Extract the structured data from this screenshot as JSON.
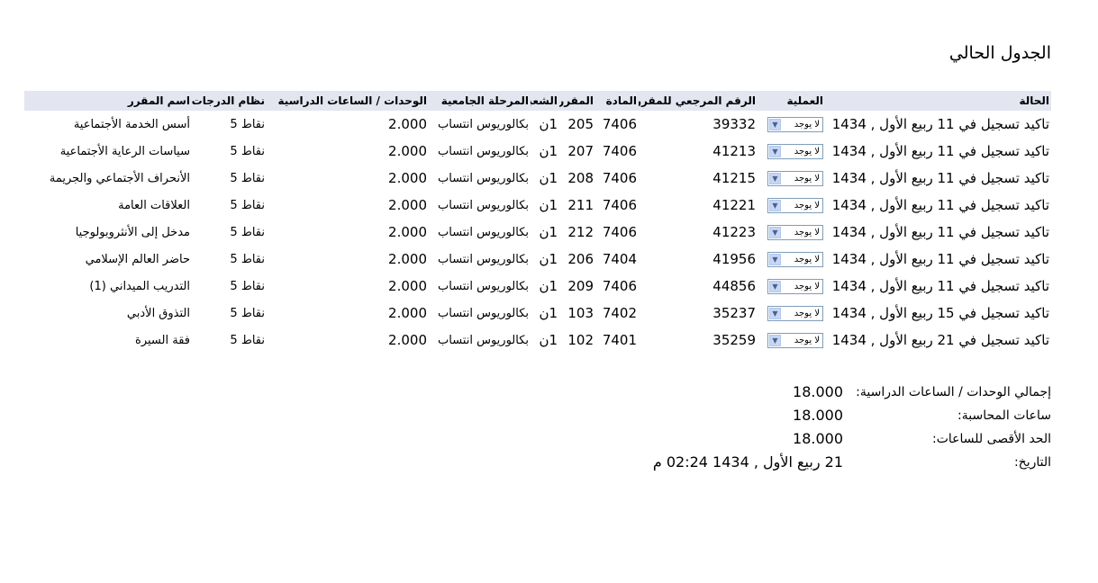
{
  "page": {
    "title": "الجدول الحالي"
  },
  "table": {
    "headers": {
      "status": "الحالة",
      "action": "العملية",
      "ref": "الرقم المرجعي للمقرر",
      "subject": "المادة",
      "course": "المقرر",
      "section": "الشعبة",
      "level": "المرحلة الجامعية",
      "units": "الوحدات / الساعات الدراسية",
      "grading": "نظام الدرجات",
      "name": "اسم المقرر"
    },
    "rows": [
      {
        "status": "تاكيد تسجيل في 11 ربيع الأول , 1434",
        "action": "لا يوجد",
        "ref": "39332",
        "subject": "7406",
        "course": "205",
        "section": "1ن",
        "level": "بكالوريوس انتساب",
        "units": "2.000",
        "grading": "نقاط 5",
        "name": "أسس الخدمة الأجتماعية"
      },
      {
        "status": "تاكيد تسجيل في 11 ربيع الأول , 1434",
        "action": "لا يوجد",
        "ref": "41213",
        "subject": "7406",
        "course": "207",
        "section": "1ن",
        "level": "بكالوريوس انتساب",
        "units": "2.000",
        "grading": "نقاط 5",
        "name": "سياسات الرعاية الأجتماعية"
      },
      {
        "status": "تاكيد تسجيل في 11 ربيع الأول , 1434",
        "action": "لا يوجد",
        "ref": "41215",
        "subject": "7406",
        "course": "208",
        "section": "1ن",
        "level": "بكالوريوس انتساب",
        "units": "2.000",
        "grading": "نقاط 5",
        "name": "الأنحراف الأجتماعي والجريمة"
      },
      {
        "status": "تاكيد تسجيل في 11 ربيع الأول , 1434",
        "action": "لا يوجد",
        "ref": "41221",
        "subject": "7406",
        "course": "211",
        "section": "1ن",
        "level": "بكالوريوس انتساب",
        "units": "2.000",
        "grading": "نقاط 5",
        "name": "العلاقات العامة"
      },
      {
        "status": "تاكيد تسجيل في 11 ربيع الأول , 1434",
        "action": "لا يوجد",
        "ref": "41223",
        "subject": "7406",
        "course": "212",
        "section": "1ن",
        "level": "بكالوريوس انتساب",
        "units": "2.000",
        "grading": "نقاط 5",
        "name": "مدخل إلى الأنثروبولوجيا"
      },
      {
        "status": "تاكيد تسجيل في 11 ربيع الأول , 1434",
        "action": "لا يوجد",
        "ref": "41956",
        "subject": "7404",
        "course": "206",
        "section": "1ن",
        "level": "بكالوريوس انتساب",
        "units": "2.000",
        "grading": "نقاط 5",
        "name": "حاضر العالم الإسلامي"
      },
      {
        "status": "تاكيد تسجيل في 11 ربيع الأول , 1434",
        "action": "لا يوجد",
        "ref": "44856",
        "subject": "7406",
        "course": "209",
        "section": "1ن",
        "level": "بكالوريوس انتساب",
        "units": "2.000",
        "grading": "نقاط 5",
        "name": "التدريب الميداني (1)"
      },
      {
        "status": "تاكيد تسجيل في 15 ربيع الأول , 1434",
        "action": "لا يوجد",
        "ref": "35237",
        "subject": "7402",
        "course": "103",
        "section": "1ن",
        "level": "بكالوريوس انتساب",
        "units": "2.000",
        "grading": "نقاط 5",
        "name": "التذوق الأدبي"
      },
      {
        "status": "تاكيد تسجيل في 21 ربيع الأول , 1434",
        "action": "لا يوجد",
        "ref": "35259",
        "subject": "7401",
        "course": "102",
        "section": "1ن",
        "level": "بكالوريوس انتساب",
        "units": "2.000",
        "grading": "نقاط 5",
        "name": "فقة السيرة"
      }
    ]
  },
  "summary": {
    "total_units_label": "إجمالي الوحدات / الساعات الدراسية:",
    "total_units_value": "18.000",
    "billing_hours_label": "ساعات المحاسبة:",
    "billing_hours_value": "18.000",
    "max_hours_label": "الحد الأقصى للساعات:",
    "max_hours_value": "18.000",
    "date_label": "التاريخ:",
    "date_value": "21 ربيع الأول , 1434 02:24 م"
  },
  "icons": {
    "select_arrow": "chevron-down-icon"
  },
  "colors": {
    "header_bg": "#e3e6f1",
    "select_border": "#7f9db9",
    "select_button": "#c5d6f7"
  }
}
